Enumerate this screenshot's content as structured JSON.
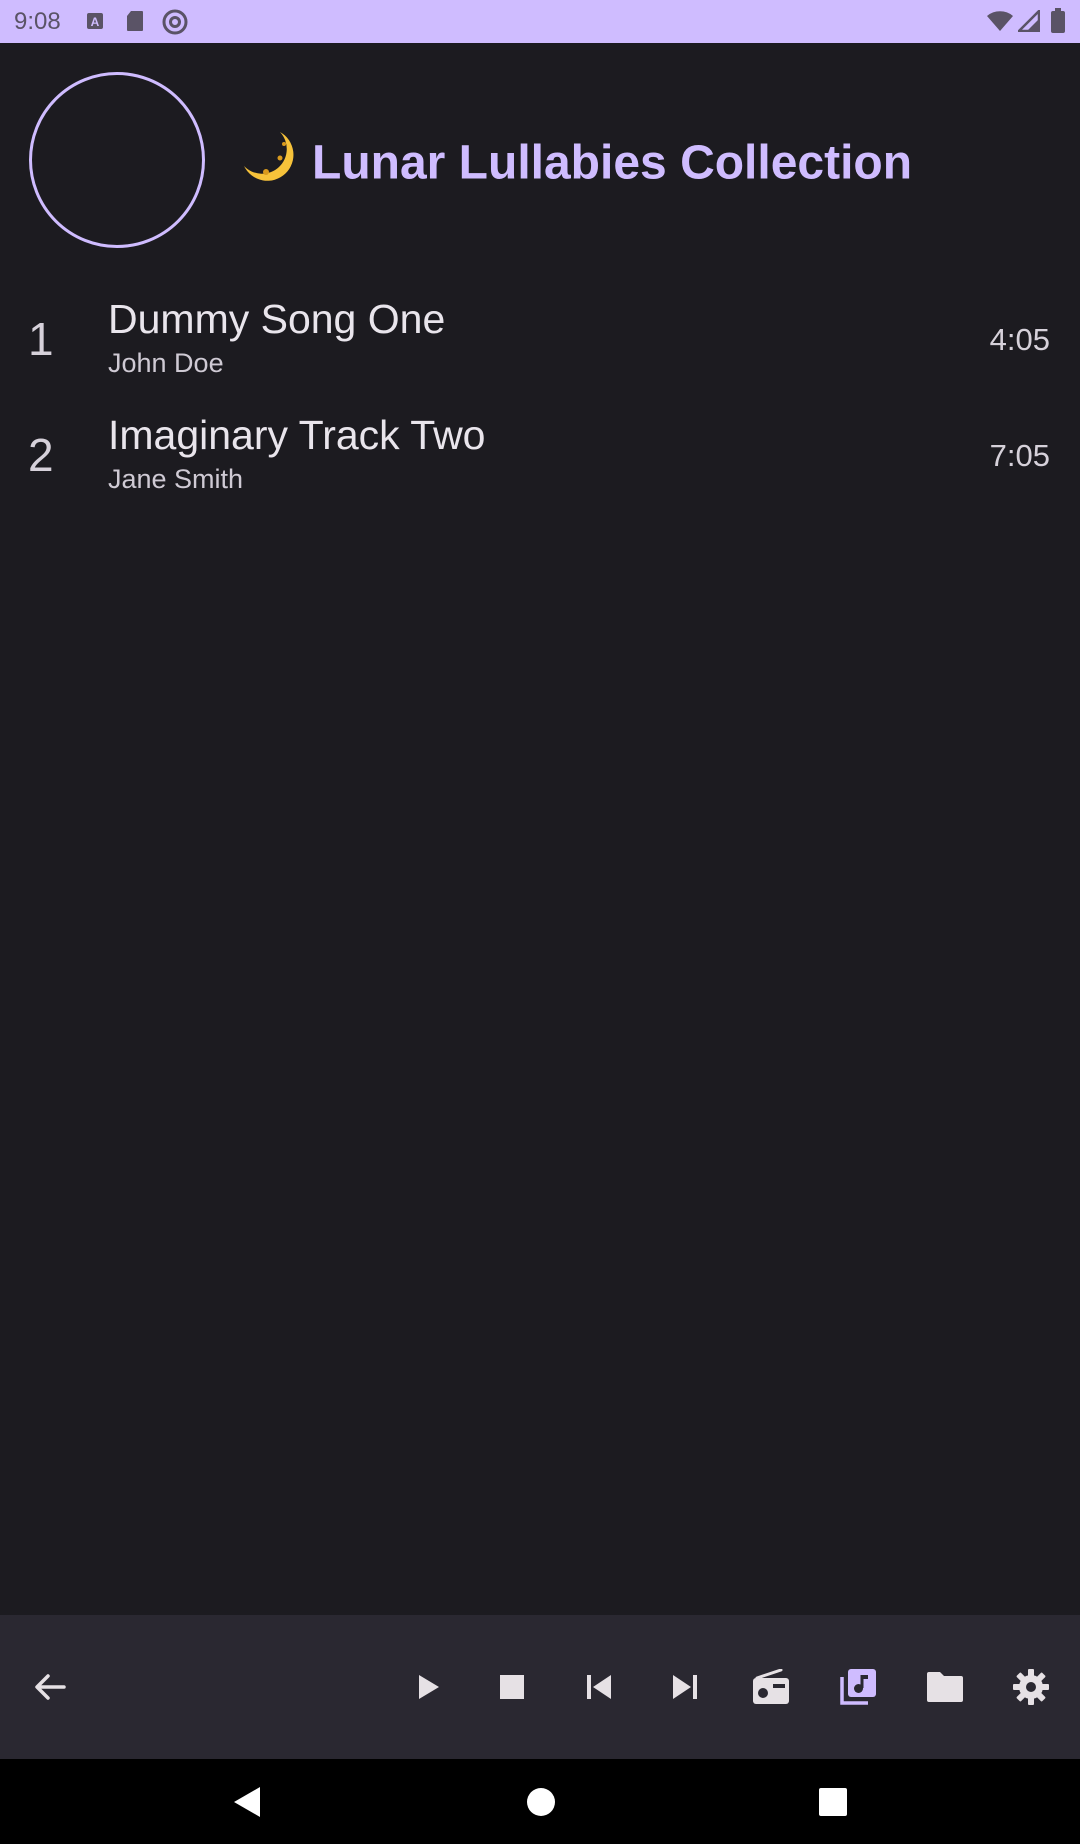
{
  "status_bar": {
    "time": "9:08",
    "left_icons": [
      "text-a-icon",
      "sd-card-icon",
      "at-sign-icon"
    ],
    "right_icons": [
      "wifi-icon",
      "cell-signal-icon",
      "battery-icon"
    ]
  },
  "album": {
    "title_emoji": "moon-icon",
    "title": "Lunar Lullabies Collection"
  },
  "tracks": [
    {
      "number": "1",
      "title": "Dummy Song One",
      "artist": "John Doe",
      "duration": "4:05"
    },
    {
      "number": "2",
      "title": "Imaginary Track Two",
      "artist": "Jane Smith",
      "duration": "7:05"
    }
  ],
  "bottom_bar": {
    "icons": [
      "back-arrow-icon",
      "play-icon",
      "stop-icon",
      "skip-previous-icon",
      "skip-next-icon",
      "radio-icon",
      "library-music-icon",
      "folder-icon",
      "settings-icon"
    ],
    "active_icon": "library-music-icon",
    "accent_color": "#cfbcff"
  },
  "nav_bar": {
    "icons": [
      "nav-back-icon",
      "nav-home-icon",
      "nav-recents-icon"
    ]
  },
  "colors": {
    "background": "#1c1b20",
    "accent": "#cfbcff",
    "status_bar": "#cfbcff",
    "bottom_bar": "#2a2831"
  }
}
